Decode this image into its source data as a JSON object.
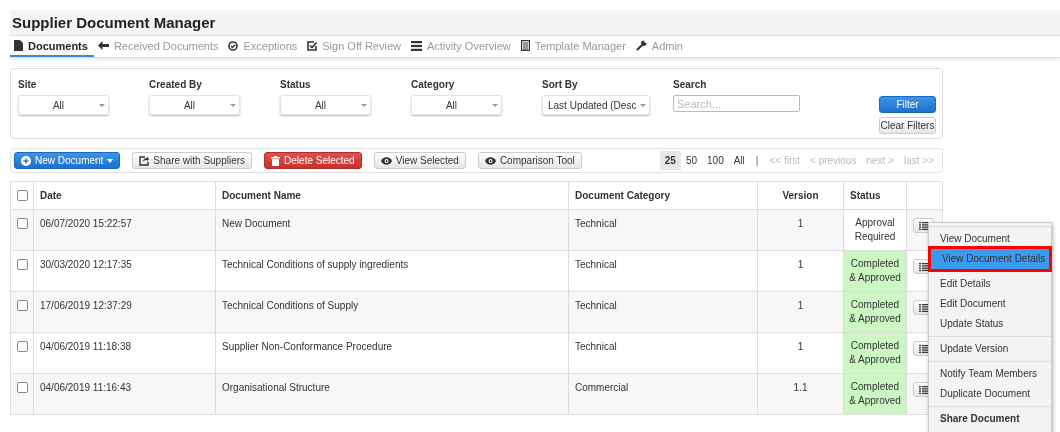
{
  "app": {
    "title": "Supplier Document Manager"
  },
  "nav_tabs": [
    {
      "label": "Documents",
      "selected": true
    },
    {
      "label": "Received Documents",
      "selected": false
    },
    {
      "label": "Exceptions",
      "selected": false
    },
    {
      "label": "Sign Off Review",
      "selected": false
    },
    {
      "label": "Activity Overview",
      "selected": false
    },
    {
      "label": "Template Manager",
      "selected": false
    },
    {
      "label": "Admin",
      "selected": false
    }
  ],
  "filters": {
    "dropdowns": [
      {
        "label": "Site",
        "value": "All"
      },
      {
        "label": "Created By",
        "value": "All"
      },
      {
        "label": "Status",
        "value": "All"
      },
      {
        "label": "Category",
        "value": "All"
      },
      {
        "label": "Sort By",
        "value": "Last Updated (Desc"
      }
    ],
    "search": {
      "label": "Search",
      "placeholder": "Search..."
    },
    "buttons": [
      {
        "label": "Filter",
        "kind": "primary"
      },
      {
        "label": "Clear Filters",
        "kind": "default"
      }
    ]
  },
  "toolbar": {
    "buttons": [
      {
        "label": "New Document",
        "kind": "primary"
      },
      {
        "label": "Share with Suppliers",
        "kind": "share"
      },
      {
        "label": "Delete Selected",
        "kind": "danger"
      },
      {
        "label": "View Selected",
        "kind": "view"
      },
      {
        "label": "Comparison Tool",
        "kind": "view"
      }
    ],
    "page_sizes": [
      {
        "label": "25",
        "selected": true
      },
      {
        "label": "50",
        "selected": false
      },
      {
        "label": "100",
        "selected": false
      },
      {
        "label": "All",
        "selected": false
      }
    ],
    "separator": "|",
    "pager": [
      {
        "label": "<< first",
        "disabled": true
      },
      {
        "label": "< previous",
        "disabled": true
      },
      {
        "label": "next >",
        "disabled": true
      },
      {
        "label": "last >>",
        "disabled": true
      }
    ]
  },
  "table": {
    "select_all_checked": false,
    "columns": [
      "Date",
      "Document Name",
      "Document Category",
      "Version",
      "Status"
    ],
    "rows": [
      {
        "checked": false,
        "date": "06/07/2020 15:22:57",
        "name": "New Document",
        "category": "Technical",
        "version": "1",
        "status": "Approval\nRequired",
        "status_highlighted": false
      },
      {
        "checked": false,
        "date": "30/03/2020 12:17:35",
        "name": "Technical Conditions of supply ingredients",
        "category": "Technical",
        "version": "1",
        "status": "Completed\n& Approved",
        "status_highlighted": true
      },
      {
        "checked": false,
        "date": "17/06/2019 12:37:29",
        "name": "Technical Conditions of Supply",
        "category": "Technical",
        "version": "1",
        "status": "Completed\n& Approved",
        "status_highlighted": true
      },
      {
        "checked": false,
        "date": "04/06/2019 11:18:38",
        "name": "Supplier Non-Conformance Procedure",
        "category": "Technical",
        "version": "1",
        "status": "Completed\n& Approved",
        "status_highlighted": true
      },
      {
        "checked": false,
        "date": "04/06/2019 11:16:43",
        "name": "Organisational Structure",
        "category": "Commercial",
        "version": "1.1",
        "status": "Completed\n& Approved",
        "status_highlighted": true
      }
    ]
  },
  "context_menu": {
    "groups": [
      [
        {
          "label": "View Document",
          "kind": "plain",
          "selected": false
        },
        {
          "label": "View Document Details",
          "kind": "plain",
          "selected": true
        }
      ],
      [
        {
          "label": "Edit Details",
          "kind": "plain",
          "selected": false
        },
        {
          "label": "Edit Document",
          "kind": "plain",
          "selected": false
        },
        {
          "label": "Update Status",
          "kind": "plain",
          "selected": false
        }
      ],
      [
        {
          "label": "Update Version",
          "kind": "plain",
          "selected": false
        }
      ],
      [
        {
          "label": "Notify Team Members",
          "kind": "plain",
          "selected": false
        },
        {
          "label": "Duplicate Document",
          "kind": "plain",
          "selected": false
        }
      ],
      [
        {
          "label": "Share Document",
          "kind": "strong",
          "selected": false
        }
      ]
    ]
  }
}
